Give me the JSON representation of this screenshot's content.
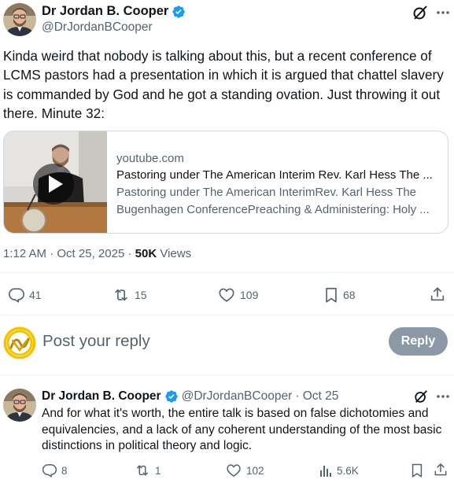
{
  "tweet": {
    "author_name": "Dr Jordan B. Cooper",
    "author_handle": "@DrJordanBCooper",
    "text": "Kinda weird that nobody is talking about this, but a recent conference of LCMS pastors had a presentation in which it is argued that chattel slavery is commanded by God and he got a standing ovation. Just throwing it out there. Minute 32:",
    "card": {
      "domain": "youtube.com",
      "title": "Pastoring under The American Interim Rev. Karl Hess The ...",
      "description_line1": "Pastoring under The American InterimRev. Karl Hess The",
      "description_line2": "Bugenhagen ConferencePreaching & Administering: Holy ..."
    },
    "time": "1:12 AM",
    "date": "Oct 25, 2025",
    "separator": " · ",
    "views_count": "50K",
    "views_label": " Views",
    "stats": {
      "replies": "41",
      "reposts": "15",
      "likes": "109",
      "bookmarks": "68"
    }
  },
  "reply_composer": {
    "placeholder": "Post your reply",
    "button_label": "Reply"
  },
  "reply": {
    "author_name": "Dr Jordan B. Cooper",
    "author_handle": "@DrJordanBCooper",
    "date_text": "· Oct 25",
    "text": "And for what it's worth, the entire talk is based on false dichotomies and equivalencies, and a lack of any coherent understanding of the most basic distinctions in political theory and logic.",
    "stats": {
      "replies": "8",
      "reposts": "1",
      "likes": "102",
      "views": "5.6K"
    }
  },
  "colors": {
    "text_primary": "#0f1419",
    "text_secondary": "#536471",
    "verified_blue": "#1d9bf0",
    "reply_button_bg": "#8b98a5",
    "border": "#cfd9de"
  },
  "icons": [
    "verified-badge-icon",
    "grok-icon",
    "more-icon",
    "reply-icon",
    "repost-icon",
    "like-icon",
    "bookmark-icon",
    "share-icon",
    "views-icon",
    "play-icon"
  ]
}
